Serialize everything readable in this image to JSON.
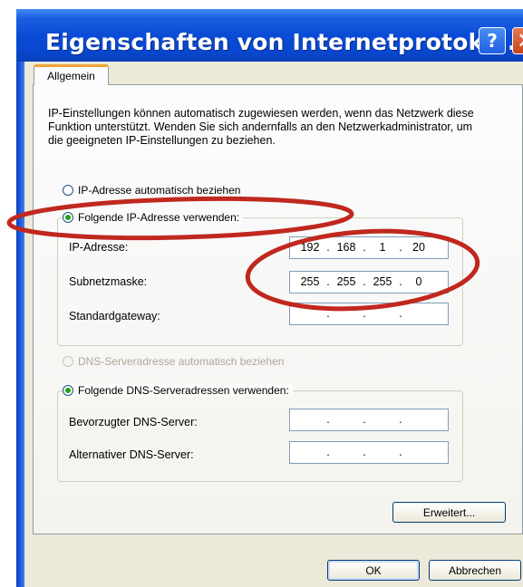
{
  "window": {
    "title": "Eigenschaften von Internetprotoko...",
    "help_glyph": "?",
    "close_glyph": "✕"
  },
  "tabs": [
    {
      "label": "Allgemein",
      "selected": true
    }
  ],
  "intro_text": "IP-Einstellungen können automatisch zugewiesen werden, wenn das Netzwerk diese Funktion unterstützt. Wenden Sie sich andernfalls an den Netzwerkadministrator, um die geeigneten IP-Einstellungen zu beziehen.",
  "ip_section": {
    "auto_label": "IP-Adresse automatisch beziehen",
    "auto_checked": false,
    "manual_label": "Folgende IP-Adresse verwenden:",
    "manual_checked": true,
    "fields": [
      {
        "label": "IP-Adresse:",
        "octets": [
          "192",
          "168",
          "1",
          "20"
        ]
      },
      {
        "label": "Subnetzmaske:",
        "octets": [
          "255",
          "255",
          "255",
          "0"
        ]
      },
      {
        "label": "Standardgateway:",
        "octets": [
          "",
          "",
          "",
          ""
        ]
      }
    ]
  },
  "dns_section": {
    "auto_label": "DNS-Serveradresse automatisch beziehen",
    "auto_enabled": false,
    "manual_label": "Folgende DNS-Serveradressen verwenden:",
    "manual_checked": true,
    "fields": [
      {
        "label": "Bevorzugter DNS-Server:",
        "octets": [
          "",
          "",
          "",
          ""
        ]
      },
      {
        "label": "Alternativer DNS-Server:",
        "octets": [
          "",
          "",
          "",
          ""
        ]
      }
    ]
  },
  "buttons": {
    "advanced": "Erweitert...",
    "ok": "OK",
    "cancel": "Abbrechen"
  },
  "colors": {
    "annotation": "#c0281e",
    "title_bar": "#0a4bd6",
    "dialog_bg": "#ece9d8",
    "radio_dot": "#21a121"
  }
}
